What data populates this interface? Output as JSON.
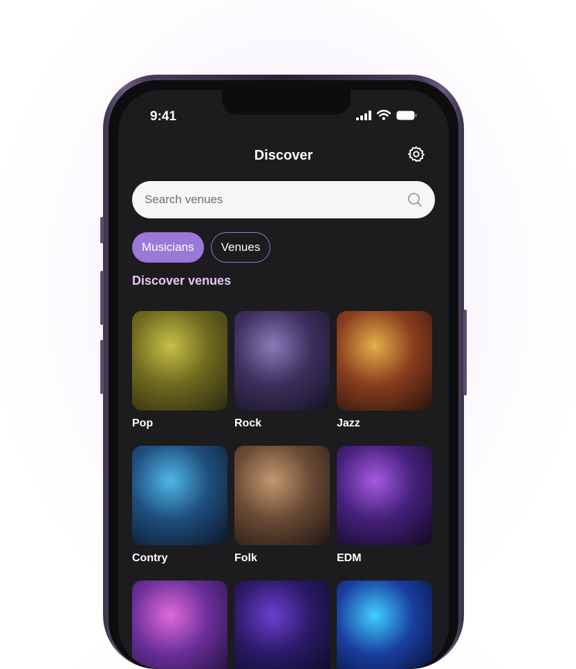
{
  "status_bar": {
    "time": "9:41"
  },
  "header": {
    "title": "Discover",
    "settings_icon": "gear-icon"
  },
  "search": {
    "placeholder": "Search venues",
    "icon": "search-icon"
  },
  "tabs": [
    {
      "label": "Musicians",
      "active": true
    },
    {
      "label": "Venues",
      "active": false
    }
  ],
  "section": {
    "title": "Discover venues"
  },
  "genres": [
    {
      "label": "Pop",
      "colors": [
        "#c7c04a",
        "#6f6a1e",
        "#2b2a10"
      ]
    },
    {
      "label": "Rock",
      "colors": [
        "#8a7bb8",
        "#3d2f5e",
        "#15121f"
      ]
    },
    {
      "label": "Jazz",
      "colors": [
        "#e4b04a",
        "#8a3e1e",
        "#2a120c"
      ]
    },
    {
      "label": "Contry",
      "colors": [
        "#4fb8e8",
        "#1f4f7e",
        "#0b1626"
      ]
    },
    {
      "label": "Folk",
      "colors": [
        "#c49870",
        "#6a4a34",
        "#1f1714"
      ]
    },
    {
      "label": "EDM",
      "colors": [
        "#a45be0",
        "#45207a",
        "#120a22"
      ]
    },
    {
      "label": "",
      "colors": [
        "#e06ad8",
        "#6a2f9a",
        "#1b0f33"
      ]
    },
    {
      "label": "",
      "colors": [
        "#6c3fd0",
        "#2a1a66",
        "#0c0a1e"
      ]
    },
    {
      "label": "",
      "colors": [
        "#3fd0ff",
        "#1a3ea0",
        "#060a24"
      ]
    }
  ],
  "colors": {
    "accent": "#9a78d8",
    "background": "#1c1b1e",
    "section_title": "#e7c8f0"
  }
}
